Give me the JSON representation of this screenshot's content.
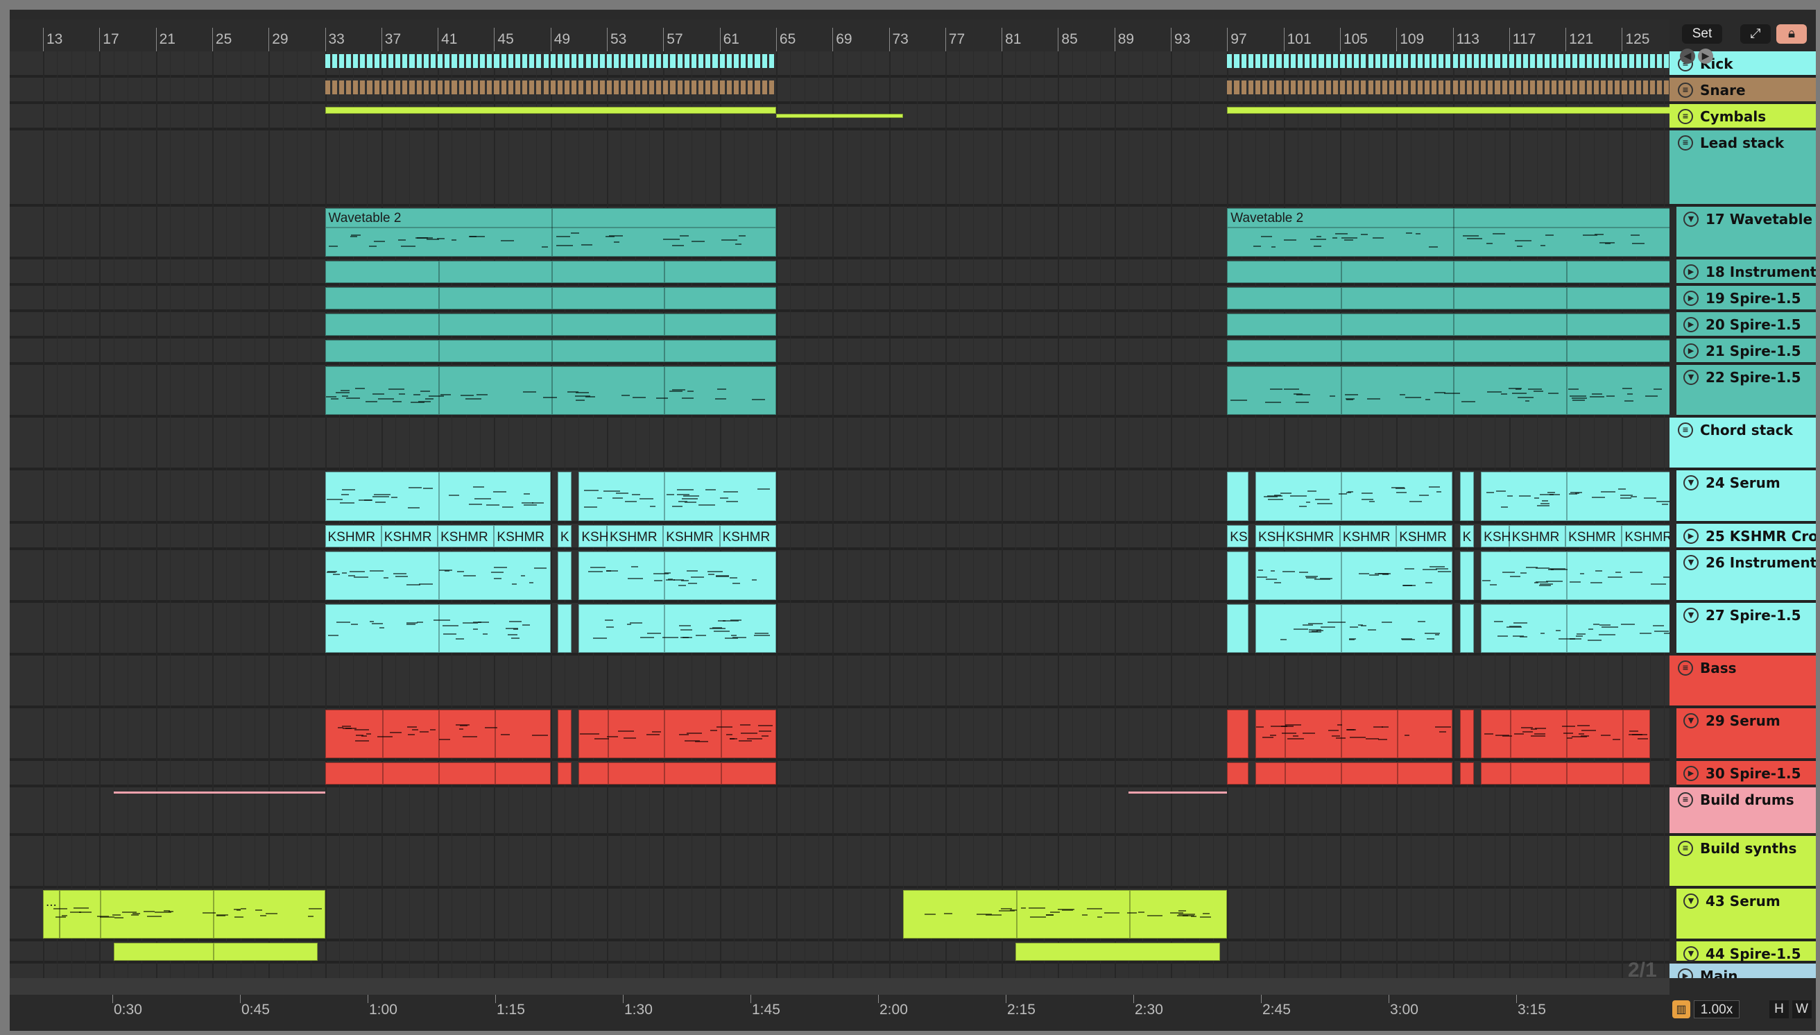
{
  "set_button": "Set",
  "page_indicator": "2/1",
  "zoom": "1.00x",
  "h_button": "H",
  "w_button": "W",
  "bars": [
    "13",
    "17",
    "21",
    "25",
    "29",
    "33",
    "37",
    "41",
    "45",
    "49",
    "53",
    "57",
    "61",
    "65",
    "69",
    "73",
    "77",
    "81",
    "85",
    "89",
    "93",
    "97",
    "101",
    "105",
    "109",
    "113",
    "117",
    "121",
    "125"
  ],
  "times": [
    "0:30",
    "0:45",
    "1:00",
    "1:15",
    "1:30",
    "1:45",
    "2:00",
    "2:15",
    "2:30",
    "2:45",
    "3:00",
    "3:15"
  ],
  "tracks": [
    {
      "name": "Kick",
      "color": "#8ff5ee",
      "icon": "group"
    },
    {
      "name": "Snare",
      "color": "#a8835c",
      "icon": "group"
    },
    {
      "name": "Cymbals",
      "color": "#c6f24a",
      "icon": "group"
    },
    {
      "name": "Lead stack",
      "color": "#58c0b0",
      "icon": "group"
    },
    {
      "name": "17 Wavetable",
      "color": "#58c0b0",
      "icon": "fold"
    },
    {
      "name": "18 Instrument",
      "color": "#58c0b0",
      "icon": "play"
    },
    {
      "name": "19 Spire-1.5",
      "color": "#58c0b0",
      "icon": "play"
    },
    {
      "name": "20 Spire-1.5",
      "color": "#58c0b0",
      "icon": "play"
    },
    {
      "name": "21 Spire-1.5",
      "color": "#58c0b0",
      "icon": "play"
    },
    {
      "name": "22 Spire-1.5",
      "color": "#58c0b0",
      "icon": "fold"
    },
    {
      "name": "Chord stack",
      "color": "#8ff5ee",
      "icon": "group"
    },
    {
      "name": "24 Serum",
      "color": "#8ff5ee",
      "icon": "fold"
    },
    {
      "name": "25 KSHMR Cro",
      "color": "#8ff5ee",
      "icon": "play"
    },
    {
      "name": "26 Instrument",
      "color": "#8ff5ee",
      "icon": "fold"
    },
    {
      "name": "27 Spire-1.5",
      "color": "#8ff5ee",
      "icon": "fold"
    },
    {
      "name": "Bass",
      "color": "#ea4c43",
      "icon": "group"
    },
    {
      "name": "29 Serum",
      "color": "#ea4c43",
      "icon": "fold"
    },
    {
      "name": "30 Spire-1.5",
      "color": "#ea4c43",
      "icon": "play"
    },
    {
      "name": "Build drums",
      "color": "#f2a2ad",
      "icon": "group"
    },
    {
      "name": "Build synths",
      "color": "#c6f24a",
      "icon": "group"
    },
    {
      "name": "43 Serum",
      "color": "#c6f24a",
      "icon": "fold"
    },
    {
      "name": "44 Spire-1.5",
      "color": "#c6f24a",
      "icon": "fold"
    },
    {
      "name": "Main",
      "color": "#a9d4e6",
      "icon": "play"
    }
  ],
  "clips": {
    "wavetable": "Wavetable 2",
    "kshmr": "KSHMR",
    "kshmr_short": "K",
    "kshmr_ks": "KS",
    "kshmr_ksh": "KSH",
    "ellipsis": "..."
  },
  "colors": {
    "lead": "#58c0b0",
    "chord": "#8ff5ee",
    "bass": "#ea4c43",
    "lime": "#c6f24a",
    "pink": "#f2a2ad",
    "snare": "#a8835c",
    "kick": "#8ff5ee"
  }
}
